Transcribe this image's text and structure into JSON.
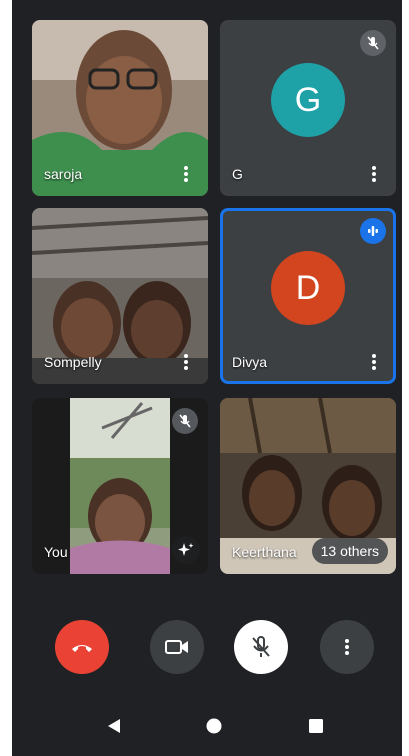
{
  "participants": [
    {
      "name": "saroja",
      "kind": "video"
    },
    {
      "name": "G",
      "kind": "avatar",
      "initial": "G",
      "avatar_color": "#1ea2a8",
      "muted": true
    },
    {
      "name": "Sompelly",
      "kind": "video"
    },
    {
      "name": "Divya",
      "kind": "avatar",
      "initial": "D",
      "avatar_color": "#d3451e",
      "speaking": true
    },
    {
      "name": "You",
      "kind": "video",
      "muted": true,
      "effects_icon": "sparkle-icon"
    },
    {
      "name": "Keerthana",
      "kind": "video",
      "others_label": "13 others"
    }
  ],
  "controls": {
    "end_call_color": "#ea4335",
    "icons": [
      "end-call-icon",
      "camera-icon",
      "mic-off-icon",
      "more-vert-icon"
    ]
  },
  "nav": {
    "icons": [
      "back-icon",
      "home-icon",
      "recents-icon"
    ]
  },
  "colors": {
    "accent": "#1a73e8",
    "background": "#202124"
  }
}
